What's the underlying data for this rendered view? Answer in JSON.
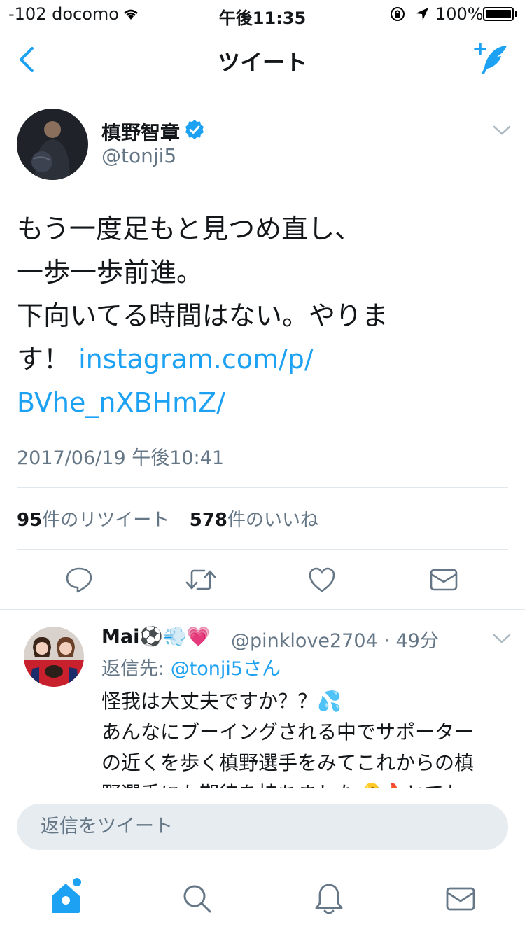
{
  "status_bar": {
    "carrier": "-102 docomo",
    "time": "午後11:35",
    "battery": "100%"
  },
  "nav": {
    "title": "ツイート"
  },
  "tweet": {
    "author_name": "槙野智章",
    "author_handle": "@tonji5",
    "text_line1": "もう一度足もと見つめ直し、",
    "text_line2": "一歩一歩前進。",
    "text_line3": "下向いてる時間はない。やりま",
    "text_line4_prefix": "す！ ",
    "link_part1": "instagram.com/p/",
    "link_part2": "BVhe_nXBHmZ/",
    "timestamp": "2017/06/19 午後10:41",
    "retweet_count": "95",
    "retweet_label": "件のリツイート",
    "like_count": "578",
    "like_label": "件のいいね"
  },
  "reply": {
    "name": "Mai⚽💨💗",
    "handle": "@pinklove2704 · 49分",
    "replying_to_label": "返信先: ",
    "replying_to_mention": "@tonji5さん",
    "text_line1": "怪我は大丈夫ですか？？💦",
    "text_line2": "あんなにブーイングされる中でサポーター",
    "text_line3": "の近くを歩く槙野選手をみてこれからの槙",
    "text_line4": "野選手にも期待を持ちました🔑🔥とても"
  },
  "compose": {
    "placeholder": "返信をツイート"
  },
  "colors": {
    "accent": "#1da1f2",
    "secondary_text": "#657786",
    "divider": "#e1e8ed",
    "icon_gray": "#657786"
  },
  "icons": [
    "back-arrow-icon",
    "compose-tweet-icon",
    "verified-icon",
    "chevron-down-icon",
    "reply-icon",
    "retweet-icon",
    "like-icon",
    "dm-icon",
    "home-icon",
    "search-icon",
    "notifications-icon",
    "messages-icon"
  ]
}
